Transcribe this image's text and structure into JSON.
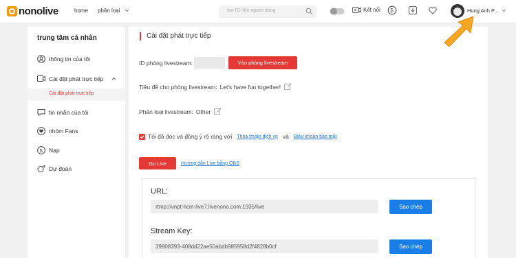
{
  "header": {
    "logo_text": "nonolive",
    "nav_home": "home",
    "nav_category": "phân loại",
    "search_placeholder": "tìm ID /tên người dùng",
    "connect_label": "Kết nối",
    "username": "Hung Anh P..."
  },
  "sidebar": {
    "title": "trung tâm cá nhân",
    "items": [
      {
        "label": "thông tin của tôi",
        "icon": "user-icon"
      },
      {
        "label": "Cài đặt phát trực tiếp",
        "icon": "video-icon"
      },
      {
        "label": "tin nhắn của tôi",
        "icon": "message-icon"
      },
      {
        "label": "nhóm Fans",
        "icon": "heart-icon"
      },
      {
        "label": "Nạp",
        "icon": "coin-icon"
      },
      {
        "label": "Dự đoán",
        "icon": "predict-icon"
      }
    ],
    "sub_item": "Cài đặt phát trực tiếp"
  },
  "main": {
    "section_title": "Cài đặt phát trực tiếp",
    "room_id_label": "ID phòng livestream:",
    "room_button": "Vào phòng livestream",
    "title_label": "Tiêu đề cho phòng livestream:",
    "title_value": "Let's have fun together!",
    "category_label": "Phân loại livestream:",
    "category_value": "Other",
    "agree_text": "Tôi đã đọc và đồng ý rõ ràng với",
    "terms_link": "Thỏa thuận dịch vụ",
    "and_text": "và",
    "privacy_link": "Điều khoản bảo mật",
    "go_live": "Go Live",
    "obs_link": "Hướng dẫn Live bằng OBS",
    "url_label": "URL:",
    "url_value": "rtmp://vnpt-hcm-live7.livenono.com:1935/live",
    "copy_label": "Sao chép",
    "key_label": "Stream Key:",
    "key_value": "39908393-408dd22ae50abdb985958d2f4828b0cf"
  },
  "colors": {
    "accent": "#e53935",
    "link": "#1e73d8",
    "button_blue": "#1a7ee8",
    "arrow": "#f5a623"
  }
}
